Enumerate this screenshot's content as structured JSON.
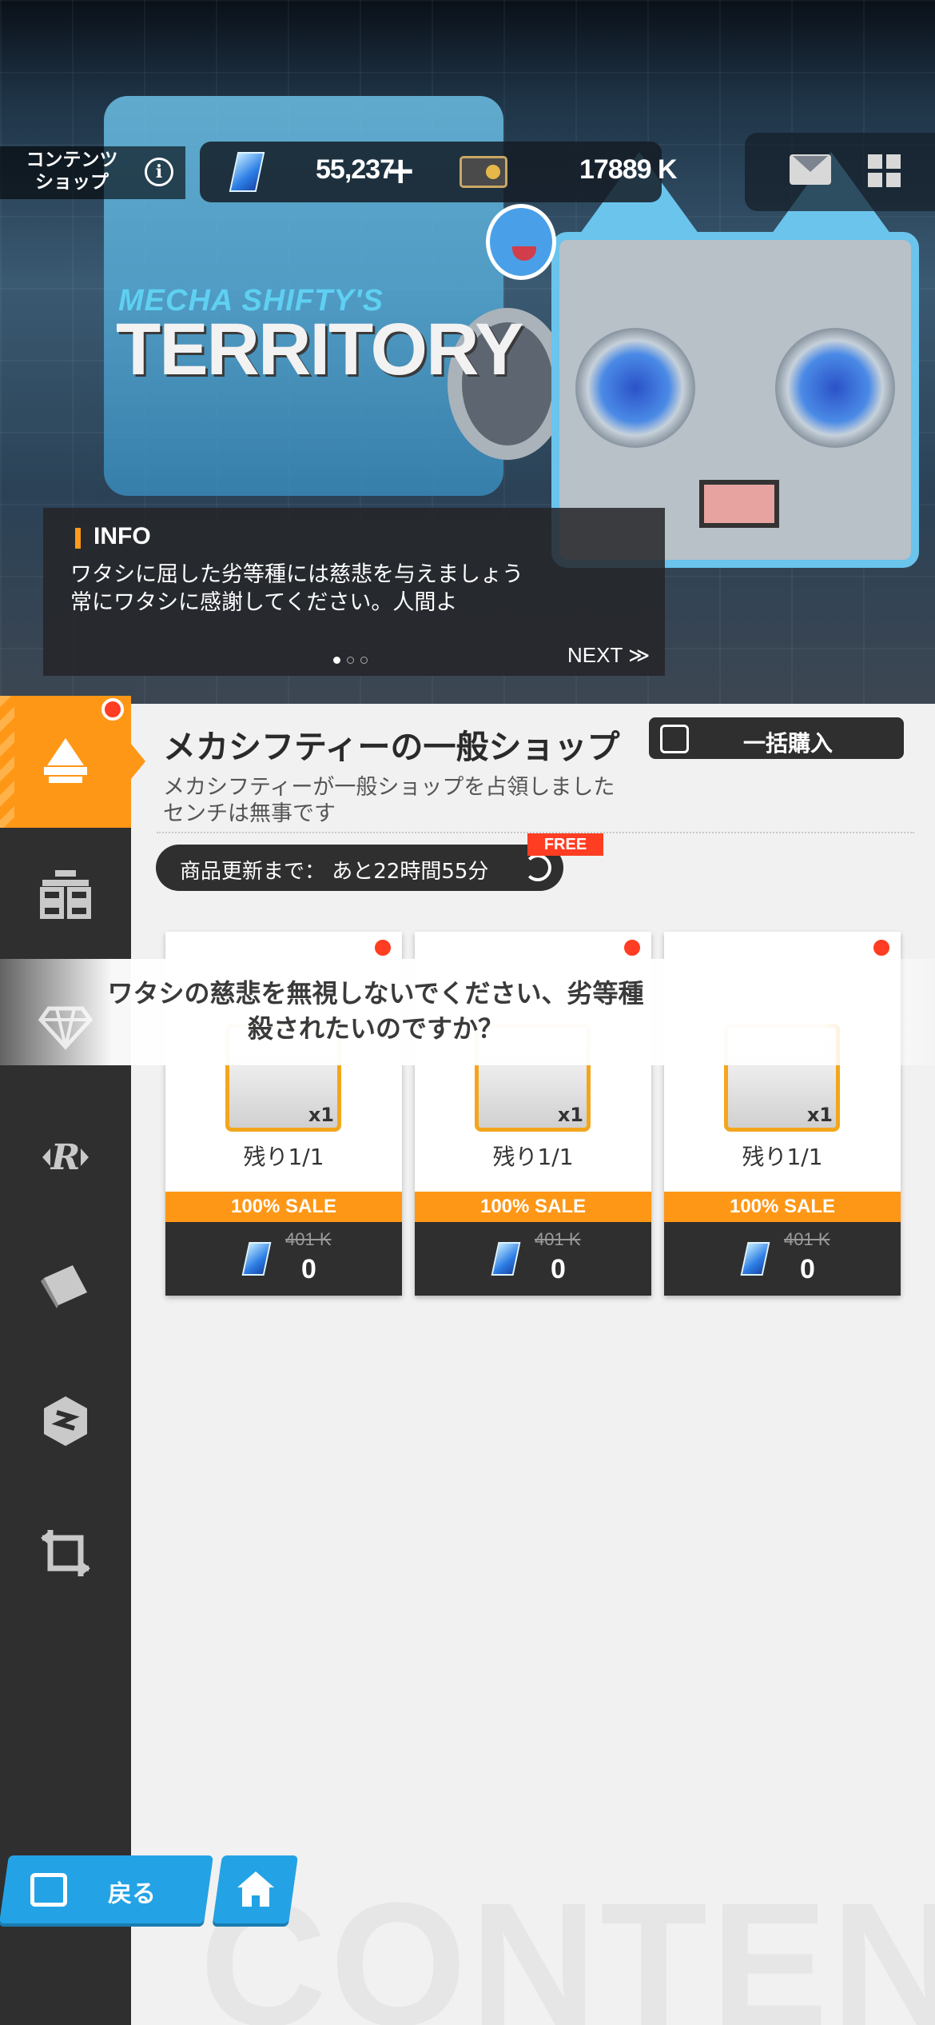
{
  "header": {
    "shop_label": "コンテンツ\nショップ",
    "gems": "55,237",
    "plus": "+",
    "coins": "17889 K"
  },
  "banner": {
    "logo_top": "MECHA SHIFTY'S",
    "logo_main": "TERRITORY",
    "info_title": "INFO",
    "info_line1": "ワタシに屈した劣等種には慈悲を与えましょう",
    "info_line2": "常にワタシに感謝してください。人間よ",
    "next": "NEXT ≫",
    "page_total": 3,
    "page_current": 1
  },
  "sidebar": {
    "items": [
      {
        "icon": "sale-shop-icon",
        "active": true,
        "badge": true
      },
      {
        "icon": "general-shop-icon",
        "active": false
      },
      {
        "icon": "diamond-icon",
        "active": false
      },
      {
        "icon": "recycle-r-icon",
        "active": false
      },
      {
        "icon": "ticket-icon",
        "active": false
      },
      {
        "icon": "hexagon-icon",
        "active": false
      },
      {
        "icon": "crop-exchange-icon",
        "active": false
      }
    ]
  },
  "shop": {
    "title": "メカシフティーの一般ショップ",
    "bulk_label": "一括購入",
    "subtitle_line1": "メカシフティーが一般ショップを占領しました",
    "subtitle_line2": "センチは無事です",
    "refresh_text": "商品更新まで： あと22時間55分",
    "free_tag": "FREE"
  },
  "products": [
    {
      "qty": "x1",
      "remain": "残り1/1",
      "sale": "100% SALE",
      "old_price": "401 K",
      "new_price": "0"
    },
    {
      "qty": "x1",
      "remain": "残り1/1",
      "sale": "100% SALE",
      "old_price": "401 K",
      "new_price": "0"
    },
    {
      "qty": "x1",
      "remain": "残り1/1",
      "sale": "100% SALE",
      "old_price": "401 K",
      "new_price": "0"
    }
  ],
  "toast": {
    "line1": "ワタシの慈悲を無視しないでください、劣等種",
    "line2": "殺されたいのですか？"
  },
  "footer": {
    "back_label": "戻る",
    "watermark": "CONTENT"
  },
  "colors": {
    "accent_orange": "#ff9716",
    "dark_panel": "#2f2f2f",
    "button_blue": "#23a3e6",
    "badge_red": "#ff3d22"
  }
}
